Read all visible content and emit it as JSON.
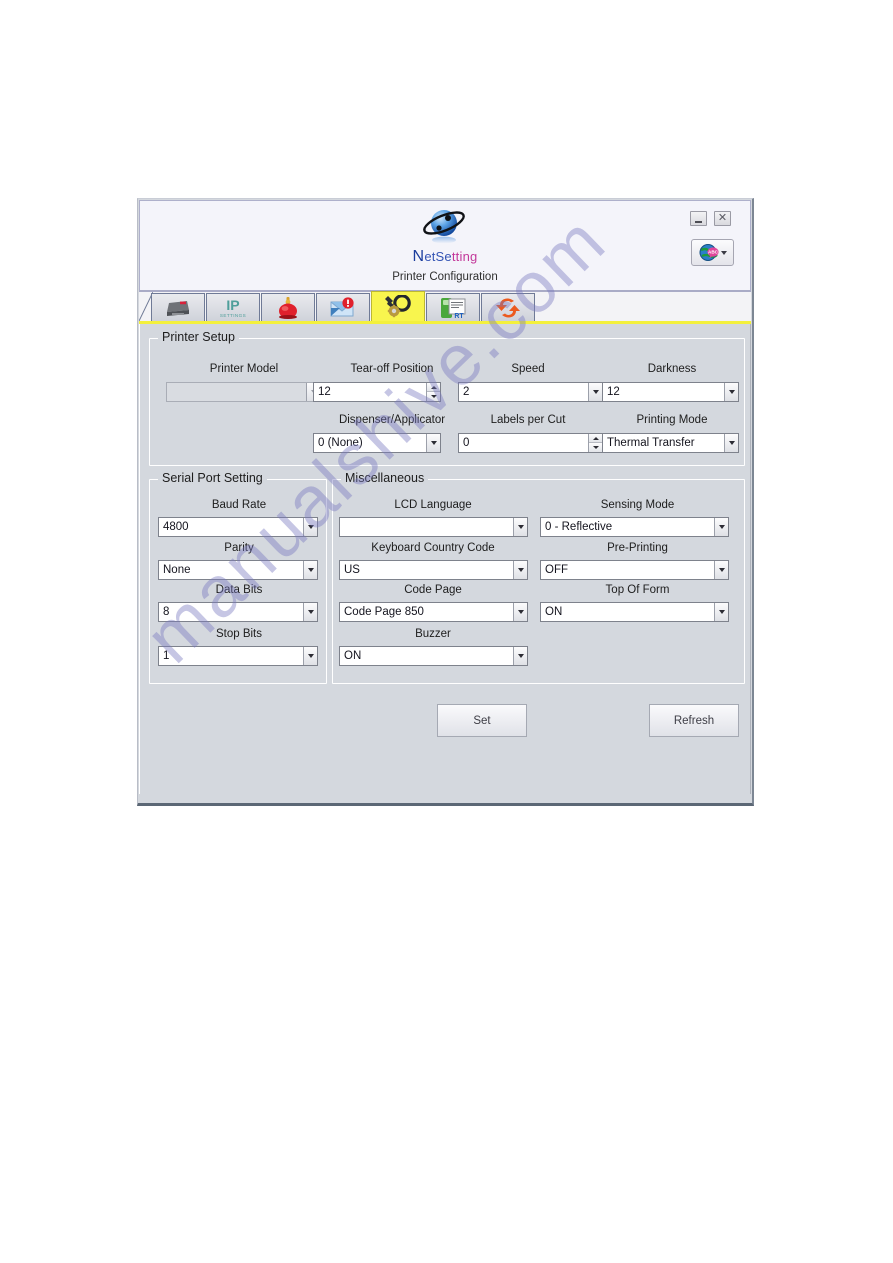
{
  "window": {
    "brand_prefix": "N",
    "brand_mid": "etSe",
    "brand_suffix": "tting",
    "brand_full": "NetSetting",
    "subtitle": "Printer Configuration",
    "minimize_label": "",
    "close_label": "✕",
    "language_button_name": "language-selector"
  },
  "tabs": [
    {
      "name": "printer",
      "icon": "printer-icon",
      "active": false
    },
    {
      "name": "ip-settings",
      "icon": "ip-settings-icon",
      "label": "IP",
      "sublabel": "SETTINGS",
      "active": false
    },
    {
      "name": "alert",
      "icon": "alarm-bell-icon",
      "active": false
    },
    {
      "name": "mail-alert",
      "icon": "mail-alert-icon",
      "active": false
    },
    {
      "name": "printer-configuration",
      "icon": "wrench-gear-icon",
      "active": true
    },
    {
      "name": "file-download",
      "icon": "file-rtf-icon",
      "label": "RT",
      "active": false
    },
    {
      "name": "reset",
      "icon": "sync-arrows-icon",
      "active": false
    }
  ],
  "printer_setup": {
    "legend": "Printer Setup",
    "fields": [
      {
        "label": "Printer Model",
        "value": "",
        "type": "combo",
        "disabled": true
      },
      {
        "label": "Tear-off  Position",
        "value": "12",
        "type": "spinner",
        "disabled": false
      },
      {
        "label": "Speed",
        "value": "2",
        "type": "combo",
        "disabled": false
      },
      {
        "label": "Darkness",
        "value": "12",
        "type": "combo",
        "disabled": false
      },
      {
        "label": "Dispenser/Applicator",
        "value": "0 (None)",
        "type": "combo",
        "disabled": false
      },
      {
        "label": "Labels per Cut",
        "value": "0",
        "type": "spinner",
        "disabled": false
      },
      {
        "label": "Printing Mode",
        "value": "Thermal Transfer",
        "type": "combo",
        "disabled": false
      }
    ]
  },
  "serial_port_setting": {
    "legend": "Serial Port Setting",
    "fields": [
      {
        "label": "Baud Rate",
        "value": "4800"
      },
      {
        "label": "Parity",
        "value": "None"
      },
      {
        "label": "Data Bits",
        "value": "8"
      },
      {
        "label": "Stop Bits",
        "value": "1"
      }
    ]
  },
  "miscellaneous": {
    "legend": "Miscellaneous",
    "left_fields": [
      {
        "label": "LCD Language",
        "value": ""
      },
      {
        "label": "Keyboard Country Code",
        "value": "US"
      },
      {
        "label": "Code Page",
        "value": "Code Page 850"
      },
      {
        "label": "Buzzer",
        "value": "ON"
      }
    ],
    "right_fields": [
      {
        "label": "Sensing Mode",
        "value": "0 - Reflective"
      },
      {
        "label": "Pre-Printing",
        "value": "OFF"
      },
      {
        "label": "Top Of Form",
        "value": "ON"
      }
    ]
  },
  "actions": {
    "set_label": "Set",
    "refresh_label": "Refresh"
  },
  "watermark": {
    "text": "manualshive.com"
  },
  "colors": {
    "window_bg": "#d4d8de",
    "titlebar_bg": "#f4f4fa",
    "active_tab": "#f8f54e",
    "tab_underline": "#f3f03c",
    "brand_blue": "#1b3c9c",
    "brand_pink": "#c3389a",
    "text": "#1d1d1d"
  }
}
